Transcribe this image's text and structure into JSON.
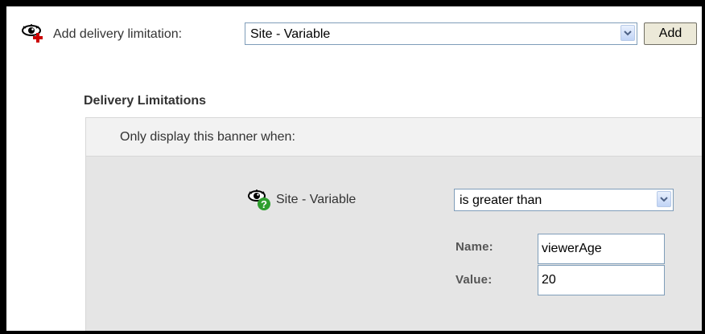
{
  "add_row": {
    "label": "Add delivery limitation:",
    "icon": "eye-add-icon",
    "selected_type": "Site - Variable",
    "add_button_label": "Add"
  },
  "section": {
    "title": "Delivery Limitations",
    "header_text": "Only display this banner when:"
  },
  "rule": {
    "icon": "eye-help-icon",
    "label": "Site - Variable",
    "operator": "is greater than",
    "name_label": "Name:",
    "name_value": "viewerAge",
    "value_label": "Value:",
    "value_value": "20"
  },
  "colors": {
    "panel_bg": "#e5e5e5",
    "header_bg": "#f2f2f2",
    "add_icon_red": "#cc0000",
    "help_icon_green": "#2e9e2e",
    "input_border": "#7f9db9"
  }
}
